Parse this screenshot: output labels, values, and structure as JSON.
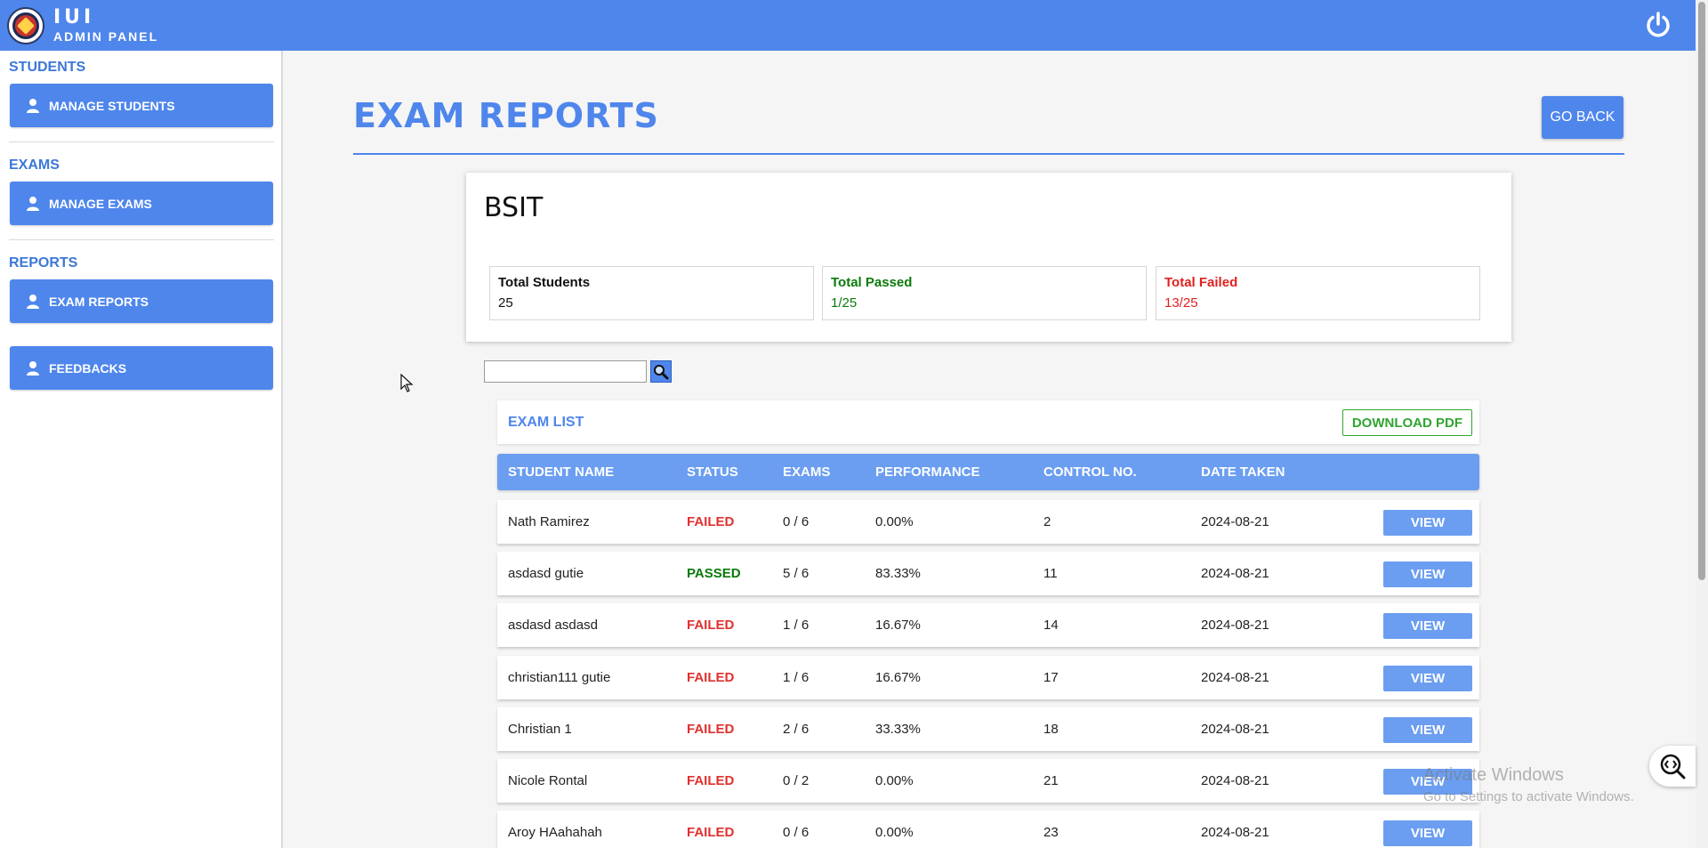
{
  "header": {
    "logo_text": "IUI",
    "subtitle": "ADMIN PANEL"
  },
  "sidebar": {
    "sections": [
      {
        "title": "STUDENTS",
        "button": "MANAGE STUDENTS"
      },
      {
        "title": "EXAMS",
        "button": "MANAGE EXAMS"
      },
      {
        "title": "REPORTS",
        "button": "EXAM REPORTS"
      }
    ],
    "feedbacks": "FEEDBACKS"
  },
  "main": {
    "title": "EXAM REPORTS",
    "go_back": "GO BACK",
    "course": "BSIT",
    "stats": {
      "total_label": "Total Students",
      "total_value": "25",
      "passed_label": "Total Passed",
      "passed_value": "1/25",
      "failed_label": "Total Failed",
      "failed_value": "13/25"
    },
    "search_value": "",
    "list_title": "EXAM LIST",
    "download_pdf": "DOWNLOAD PDF",
    "columns": [
      "STUDENT NAME",
      "STATUS",
      "EXAMS",
      "PERFORMANCE",
      "CONTROL NO.",
      "DATE TAKEN"
    ],
    "view_label": "VIEW",
    "rows": [
      {
        "name": "Nath Ramirez",
        "status": "FAILED",
        "exams": "0 / 6",
        "performance": "0.00%",
        "control": "2",
        "date": "2024-08-21"
      },
      {
        "name": "asdasd gutie",
        "status": "PASSED",
        "exams": "5 / 6",
        "performance": "83.33%",
        "control": "11",
        "date": "2024-08-21"
      },
      {
        "name": "asdasd asdasd",
        "status": "FAILED",
        "exams": "1 / 6",
        "performance": "16.67%",
        "control": "14",
        "date": "2024-08-21"
      },
      {
        "name": "christian111 gutie",
        "status": "FAILED",
        "exams": "1 / 6",
        "performance": "16.67%",
        "control": "17",
        "date": "2024-08-21"
      },
      {
        "name": "Christian 1",
        "status": "FAILED",
        "exams": "2 / 6",
        "performance": "33.33%",
        "control": "18",
        "date": "2024-08-21"
      },
      {
        "name": "Nicole Rontal",
        "status": "FAILED",
        "exams": "0 / 2",
        "performance": "0.00%",
        "control": "21",
        "date": "2024-08-21"
      },
      {
        "name": "Aroy HAahahah",
        "status": "FAILED",
        "exams": "0 / 6",
        "performance": "0.00%",
        "control": "23",
        "date": "2024-08-21"
      }
    ]
  },
  "watermark": {
    "line1": "Activate Windows",
    "line2": "Go to Settings to activate Windows."
  },
  "icons": {
    "logo": "school-logo-icon",
    "power": "power-icon",
    "user": "user-icon",
    "search": "search-icon",
    "zoom": "zoom-inspect-icon",
    "cursor": "mouse-cursor-icon"
  },
  "colors": {
    "primary": "#4f86ec",
    "table_header": "#6b9ef0",
    "passed": "#0a7a0a",
    "failed": "#e0312f",
    "download": "#2fa52f"
  }
}
